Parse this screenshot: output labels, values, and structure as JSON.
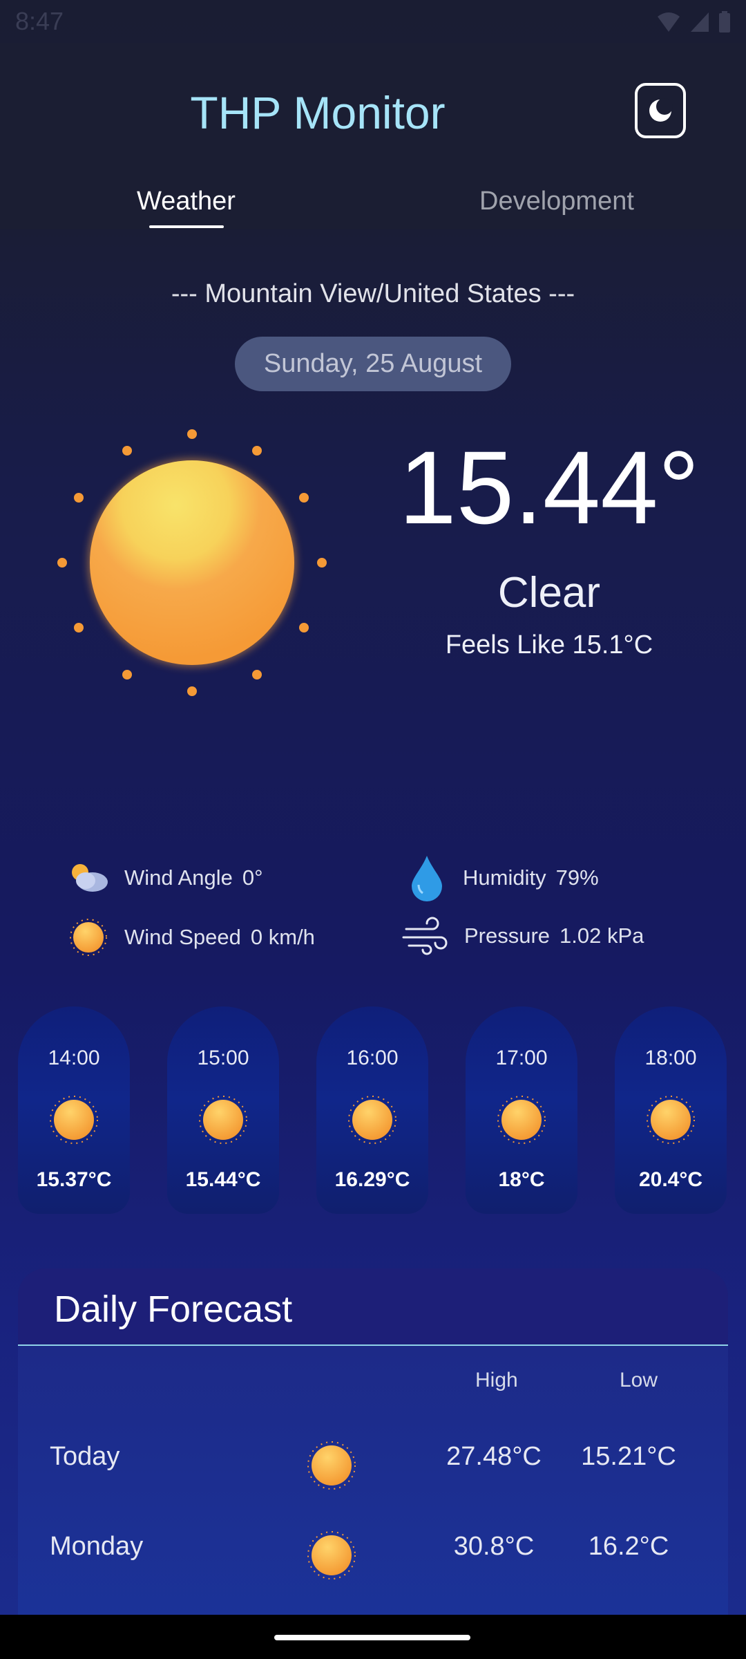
{
  "status": {
    "time": "8:47"
  },
  "header": {
    "title": "THP Monitor",
    "theme_icon": "moon-icon"
  },
  "tabs": [
    {
      "label": "Weather",
      "active": true
    },
    {
      "label": "Development",
      "active": false
    }
  ],
  "location": "--- Mountain View/United States ---",
  "date": "Sunday, 25 August",
  "current": {
    "temperature": "15.44°",
    "condition": "Clear",
    "feels_like": "Feels Like 15.1°C",
    "icon": "sun-icon"
  },
  "stats": {
    "wind_angle": {
      "label": "Wind Angle",
      "value": "0°",
      "icon": "partly-cloudy-icon"
    },
    "wind_speed": {
      "label": "Wind Speed",
      "value": "0 km/h",
      "icon": "sun-icon"
    },
    "humidity": {
      "label": "Humidity",
      "value": "79%",
      "icon": "water-drop-icon"
    },
    "pressure": {
      "label": "Pressure",
      "value": "1.02 kPa",
      "icon": "wind-icon"
    }
  },
  "hourly": [
    {
      "time": "14:00",
      "temp": "15.37°C",
      "icon": "sun-icon"
    },
    {
      "time": "15:00",
      "temp": "15.44°C",
      "icon": "sun-icon"
    },
    {
      "time": "16:00",
      "temp": "16.29°C",
      "icon": "sun-icon"
    },
    {
      "time": "17:00",
      "temp": "18°C",
      "icon": "sun-icon"
    },
    {
      "time": "18:00",
      "temp": "20.4°C",
      "icon": "sun-icon"
    }
  ],
  "daily": {
    "title": "Daily Forecast",
    "col_high": "High",
    "col_low": "Low",
    "rows": [
      {
        "day": "Today",
        "high": "27.48°C",
        "low": "15.21°C",
        "icon": "sun-icon"
      },
      {
        "day": "Monday",
        "high": "30.8°C",
        "low": "16.2°C",
        "icon": "sun-icon"
      }
    ]
  },
  "colors": {
    "title": "#a6e4f8",
    "accent_sun": "#f7a23b",
    "card": "#10268a"
  }
}
